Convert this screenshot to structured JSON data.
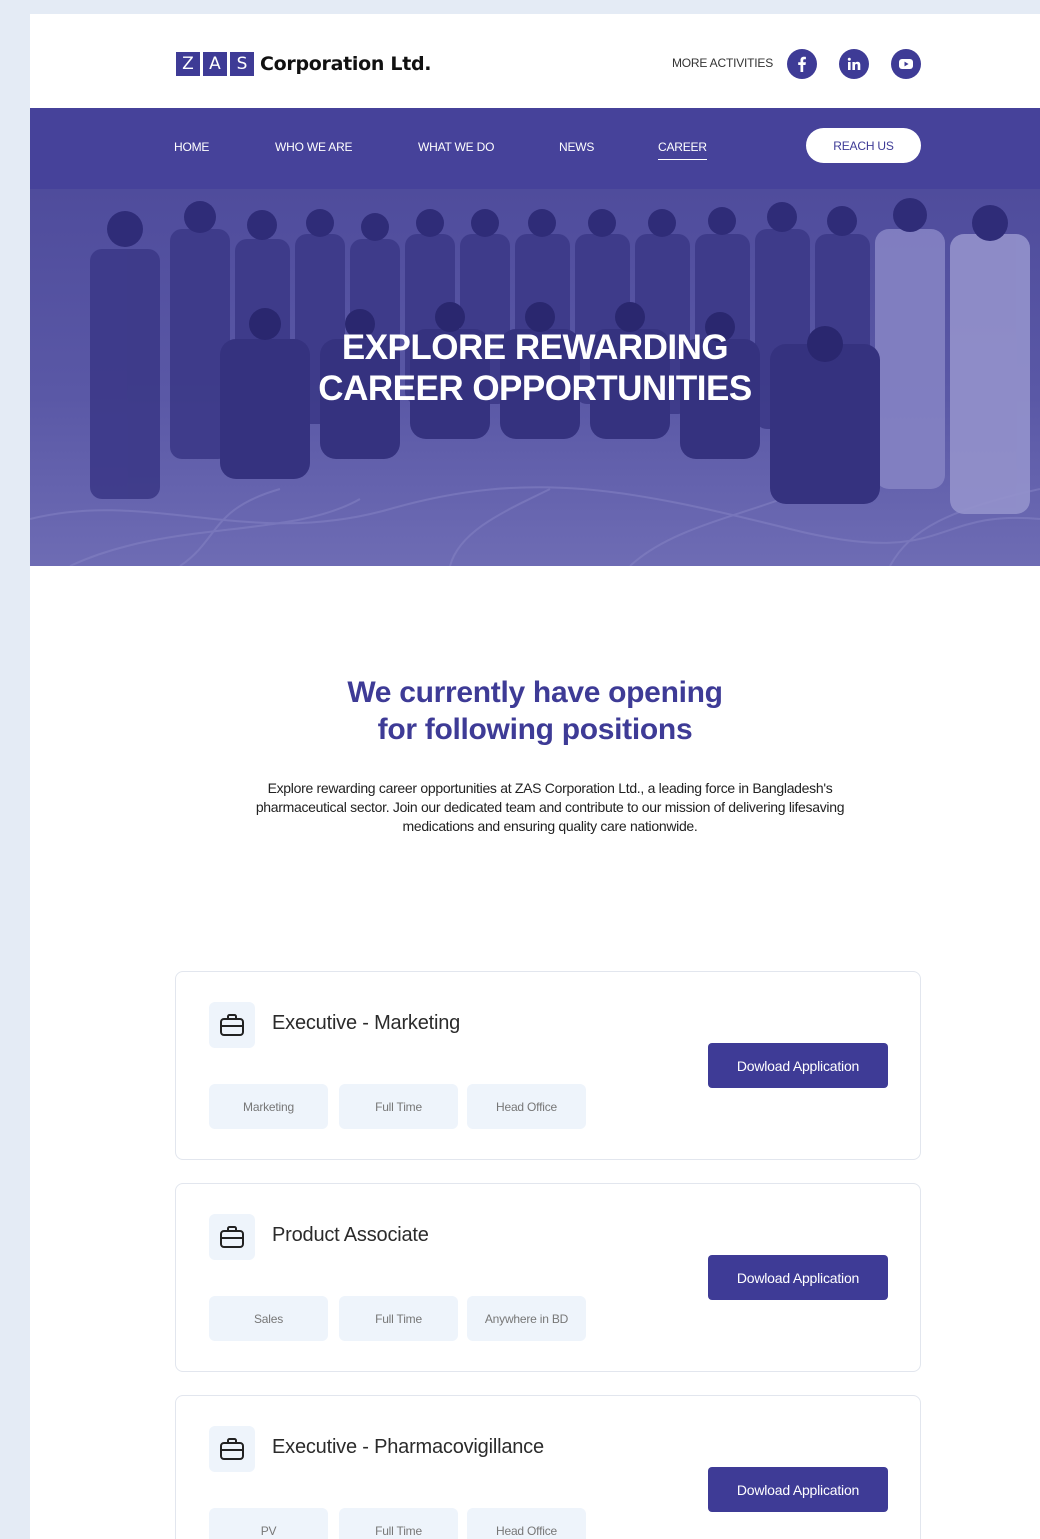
{
  "brand": {
    "logo_letters": [
      "Z",
      "A",
      "S"
    ],
    "name": "Corporation Ltd."
  },
  "topbar": {
    "more_activities": "MORE ACTIVITIES",
    "social": [
      {
        "name": "facebook-icon"
      },
      {
        "name": "linkedin-icon"
      },
      {
        "name": "youtube-icon"
      }
    ]
  },
  "nav": {
    "items": [
      {
        "label": "HOME"
      },
      {
        "label": "WHO WE ARE"
      },
      {
        "label": "WHAT WE DO"
      },
      {
        "label": "NEWS"
      },
      {
        "label": "CAREER",
        "active": true
      }
    ],
    "reach_us": "REACH US"
  },
  "hero": {
    "title_line1": "EXPLORE REWARDING",
    "title_line2": "CAREER OPPORTUNITIES"
  },
  "intro": {
    "title_line1": "We currently have opening",
    "title_line2": "for following positions",
    "text_line1": "Explore rewarding career opportunities at ZAS Corporation Ltd., a leading force in Bangladesh's",
    "text_line2": "pharmaceutical sector. Join our dedicated team and contribute to our mission of delivering lifesaving",
    "text_line3": "medications and ensuring quality care nationwide."
  },
  "jobs": [
    {
      "title": "Executive - Marketing",
      "tags": [
        "Marketing",
        "Full Time",
        "Head Office"
      ],
      "button": "Dowload Application"
    },
    {
      "title": "Product Associate",
      "tags": [
        "Sales",
        "Full Time",
        "Anywhere in BD"
      ],
      "button": "Dowload Application"
    },
    {
      "title": "Executive - Pharmacovigillance",
      "tags": [
        "PV",
        "Full Time",
        "Head Office"
      ],
      "button": "Dowload Application"
    }
  ],
  "colors": {
    "brand": "#3e3b96",
    "nav_bg": "#46429a",
    "tag_bg": "#eef4fb",
    "page_bg": "#e4ebf5"
  }
}
